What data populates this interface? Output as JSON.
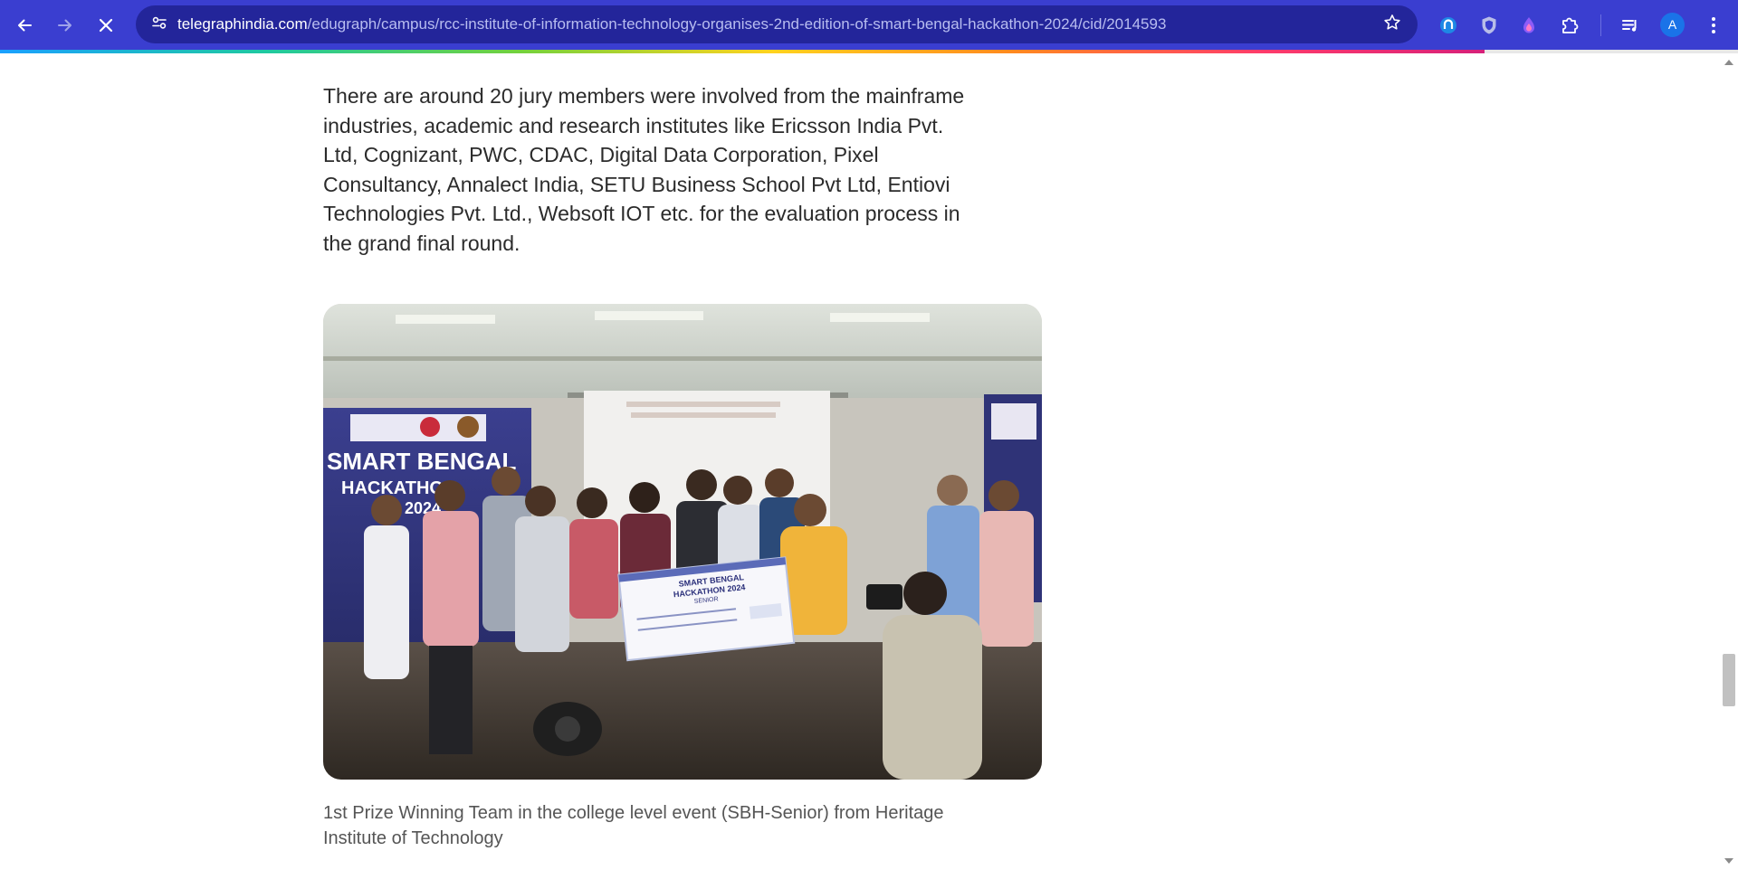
{
  "browser": {
    "url_host": "telegraphindia.com",
    "url_path": "/edugraph/campus/rcc-institute-of-information-technology-organises-2nd-edition-of-smart-bengal-hackathon-2024/cid/2014593",
    "profile_initial": "A",
    "icons": [
      "back-icon",
      "forward-icon",
      "stop-loading-icon",
      "site-info-icon",
      "bookmark-star-icon",
      "extension-icon",
      "puzzle-extensions-icon",
      "media-controls-icon",
      "more-menu-icon"
    ],
    "colors": {
      "toolbar": "#3a3ed0",
      "omnibox": "#23259a",
      "avatar": "#1a73e8"
    }
  },
  "article": {
    "paragraph": "There are around 20 jury members were involved from the mainframe industries, academic and research institutes like Ericsson India Pvt. Ltd, Cognizant, PWC, CDAC, Digital Data Corporation, Pixel Consultancy, Annalect India, SETU Business School Pvt Ltd, Entiovi Technologies Pvt. Ltd., Websoft IOT etc. for the evaluation process in the grand final round.",
    "photo": {
      "banner_line1": "SMART BENGAL",
      "banner_line2": "HACKATHON",
      "banner_line3": "2024",
      "cheque_line1": "SMART BENGAL",
      "cheque_line2": "HACKATHON 2024",
      "cheque_line3": "SENIOR"
    },
    "caption": "1st Prize Winning Team in the college level event (SBH-Senior) from Heritage Institute of Technology"
  }
}
